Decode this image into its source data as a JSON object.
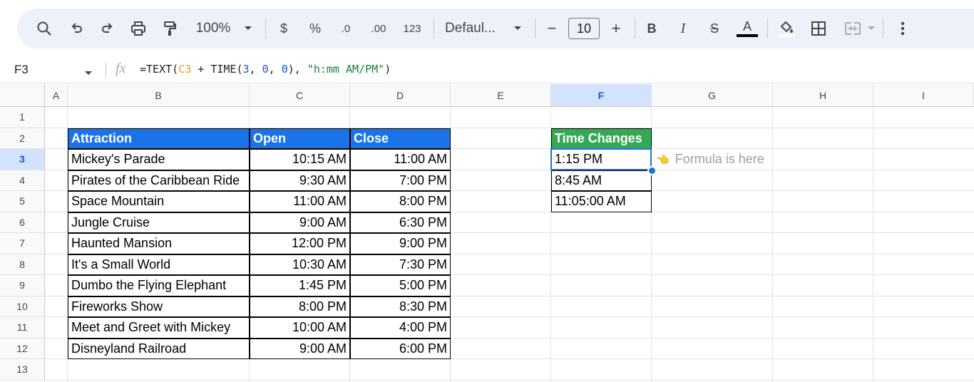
{
  "toolbar": {
    "zoom": "100%",
    "currency": "$",
    "percent": "%",
    "dec_decrease": ".0",
    "dec_increase": ".00",
    "more_formats": "123",
    "font": "Defaul...",
    "minus": "−",
    "font_size": "10",
    "plus": "+",
    "bold": "B",
    "italic": "I",
    "strike": "S",
    "text_color": "A"
  },
  "formula_bar": {
    "cell_ref": "F3",
    "parts": [
      "=TEXT(",
      "C3",
      " + TIME(",
      "3",
      ", ",
      "0",
      ", ",
      "0",
      "), ",
      "\"h:mm AM/PM\"",
      ")"
    ]
  },
  "columns": [
    "A",
    "B",
    "C",
    "D",
    "E",
    "F",
    "G",
    "H",
    "I"
  ],
  "rows": [
    "1",
    "2",
    "3",
    "4",
    "5",
    "6",
    "7",
    "8",
    "9",
    "10",
    "11",
    "12",
    "13"
  ],
  "table": {
    "headers": [
      "Attraction",
      "Open",
      "Close"
    ],
    "rows": [
      [
        "Mickey's Parade",
        "10:15 AM",
        "11:00 AM"
      ],
      [
        "Pirates of the Caribbean Ride",
        "9:30 AM",
        "7:00 PM"
      ],
      [
        "Space Mountain",
        "11:00 AM",
        "8:00 PM"
      ],
      [
        "Jungle Cruise",
        "9:00 AM",
        "6:30 PM"
      ],
      [
        "Haunted Mansion",
        "12:00 PM",
        "9:00 PM"
      ],
      [
        "It's a Small World",
        "10:30 AM",
        "7:30 PM"
      ],
      [
        "Dumbo the Flying Elephant",
        "1:45 PM",
        "5:00 PM"
      ],
      [
        "Fireworks Show",
        "8:00 PM",
        "8:30 PM"
      ],
      [
        "Meet and Greet with Mickey",
        "10:00 AM",
        "4:00 PM"
      ],
      [
        "Disneyland Railroad",
        "9:00 AM",
        "6:00 PM"
      ]
    ]
  },
  "time_changes": {
    "header": "Time Changes",
    "values": [
      "1:15 PM",
      "8:45 AM",
      "11:05:00 AM"
    ]
  },
  "note": {
    "emoji": "👈",
    "text": "Formula is here"
  },
  "colors": {
    "accent": "#1a73e8",
    "header_blue": "#1a73e8",
    "header_green": "#34a853"
  }
}
